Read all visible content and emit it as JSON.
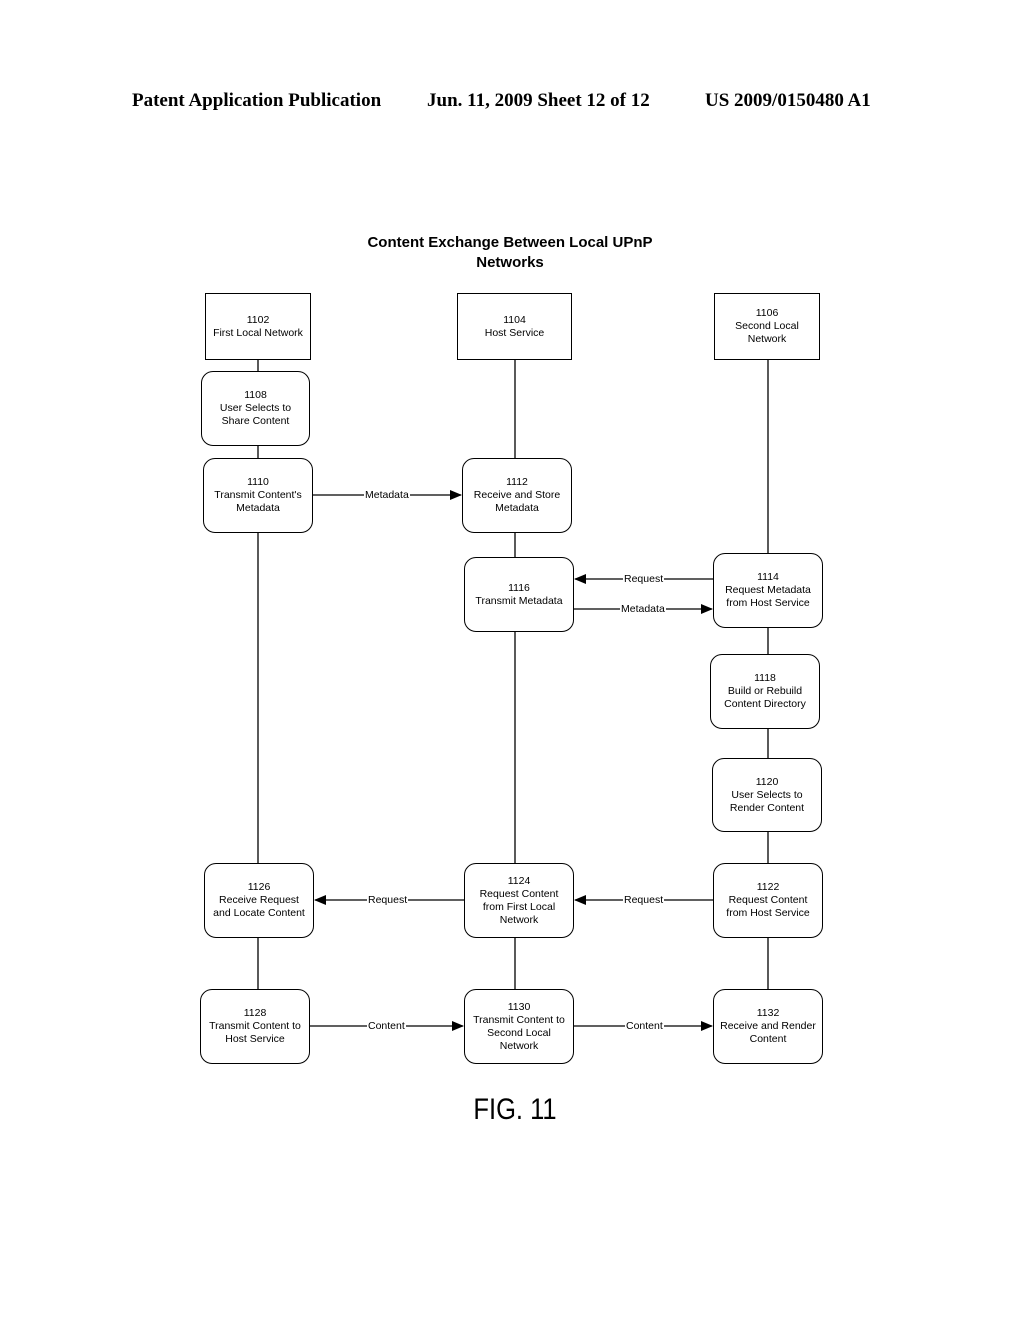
{
  "header": {
    "publication": "Patent Application Publication",
    "date_sheet": "Jun. 11, 2009  Sheet 12 of 12",
    "number": "US 2009/0150480 A1"
  },
  "diagram": {
    "title_line1": "Content Exchange Between Local UPnP",
    "title_line2": "Networks",
    "figure_label": "FIG. 11",
    "nodes": {
      "n1102": {
        "id": "1102",
        "lines": [
          "First Local Network"
        ]
      },
      "n1104": {
        "id": "1104",
        "lines": [
          "Host Service"
        ]
      },
      "n1106": {
        "id": "1106",
        "lines": [
          "Second Local",
          "Network"
        ]
      },
      "n1108": {
        "id": "1108",
        "lines": [
          "User Selects to",
          "Share Content"
        ]
      },
      "n1110": {
        "id": "1110",
        "lines": [
          "Transmit Content's",
          "Metadata"
        ]
      },
      "n1112": {
        "id": "1112",
        "lines": [
          "Receive and Store",
          "Metadata"
        ]
      },
      "n1114": {
        "id": "1114",
        "lines": [
          "Request Metadata",
          "from Host Service"
        ]
      },
      "n1116": {
        "id": "1116",
        "lines": [
          "Transmit Metadata"
        ]
      },
      "n1118": {
        "id": "1118",
        "lines": [
          "Build or Rebuild",
          "Content Directory"
        ]
      },
      "n1120": {
        "id": "1120",
        "lines": [
          "User Selects to",
          "Render Content"
        ]
      },
      "n1122": {
        "id": "1122",
        "lines": [
          "Request Content",
          "from Host Service"
        ]
      },
      "n1124": {
        "id": "1124",
        "lines": [
          "Request Content",
          "from First Local",
          "Network"
        ]
      },
      "n1126": {
        "id": "1126",
        "lines": [
          "Receive Request",
          "and Locate Content"
        ]
      },
      "n1128": {
        "id": "1128",
        "lines": [
          "Transmit Content to",
          "Host Service"
        ]
      },
      "n1130": {
        "id": "1130",
        "lines": [
          "Transmit Content to",
          "Second Local",
          "Network"
        ]
      },
      "n1132": {
        "id": "1132",
        "lines": [
          "Receive and Render",
          "Content"
        ]
      }
    },
    "edges": {
      "e1110_1112": {
        "from": "1110",
        "to": "1112",
        "label": "Metadata"
      },
      "e1114_1116": {
        "from": "1114",
        "to": "1116",
        "label": "Request"
      },
      "e1116_1114": {
        "from": "1116",
        "to": "1114",
        "label": "Metadata"
      },
      "e1122_1124": {
        "from": "1122",
        "to": "1124",
        "label": "Request"
      },
      "e1124_1126": {
        "from": "1124",
        "to": "1126",
        "label": "Request"
      },
      "e1128_1130": {
        "from": "1128",
        "to": "1130",
        "label": "Content"
      },
      "e1130_1132": {
        "from": "1130",
        "to": "1132",
        "label": "Content"
      }
    }
  }
}
